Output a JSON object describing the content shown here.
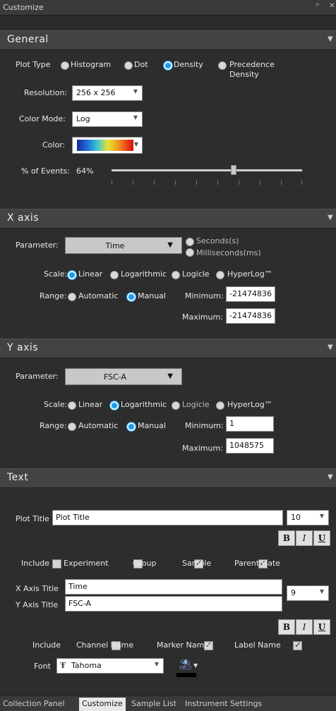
{
  "window": {
    "title": "Customize",
    "pin": "ᵖ",
    "close": "✕"
  },
  "general": {
    "header": "General",
    "plot_type_label": "Plot Type",
    "plot_types": [
      "Histogram",
      "Dot",
      "Density",
      "Precedence",
      "Density"
    ],
    "resolution_label": "Resolution:",
    "resolution_value": "256 x 256",
    "color_mode_label": "Color Mode:",
    "color_mode_value": "Log",
    "color_label": "Color:",
    "events_label": "% of Events:",
    "events_value": "64%",
    "events_fraction": 0.64
  },
  "xaxis": {
    "header": "X axis",
    "parameter_label": "Parameter:",
    "parameter_value": "Time",
    "seconds_label": "Seconds(s)",
    "ms_label": "Milliseconds(ms)",
    "scale_label": "Scale:",
    "scales": [
      "Linear",
      "Logarithmic",
      "Logicle",
      "HyperLog™"
    ],
    "range_label": "Range:",
    "automatic": "Automatic",
    "manual": "Manual",
    "min_label": "Minimum:",
    "min_value": "-21474836",
    "max_label": "Maximum:",
    "max_value": "-21474836"
  },
  "yaxis": {
    "header": "Y axis",
    "parameter_label": "Parameter:",
    "parameter_value": "FSC-A",
    "scale_label": "Scale:",
    "scales": [
      "Linear",
      "Logarithmic",
      "Logicle",
      "HyperLog™"
    ],
    "range_label": "Range:",
    "automatic": "Automatic",
    "manual": "Manual",
    "min_label": "Minimum:",
    "min_value": "1",
    "max_label": "Maximum:",
    "max_value": "1048575"
  },
  "text": {
    "header": "Text",
    "plot_title_label": "Plot Title",
    "plot_title_value": "Plot Title",
    "plot_title_size": "10",
    "bold": "B",
    "italic": "I",
    "underline": "U",
    "include_label": "Include",
    "include_items": [
      "Experiment",
      "Group",
      "Sample",
      "Parent Gate"
    ],
    "x_title_label": "X Axis Title",
    "x_title_value": "Time",
    "y_title_label": "Y Axis Title",
    "y_title_value": "FSC-A",
    "axis_title_size": "9",
    "include2_label": "Include",
    "include2_items": [
      "Channel Name",
      "Marker Name",
      "Label Name"
    ],
    "font_label": "Font",
    "font_glyph": "Ŧ",
    "font_value": "Tahoma"
  },
  "tabs": [
    "Collection Panel",
    "Customize",
    "Sample List",
    "Instrument Settings"
  ],
  "colors": {
    "accent": "#1e9be9",
    "panel": "#2d2d2d",
    "header": "#434343"
  }
}
